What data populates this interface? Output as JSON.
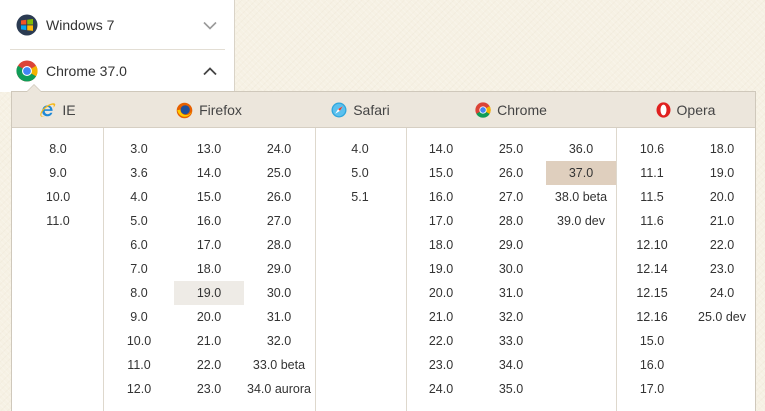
{
  "selector": {
    "os": {
      "label": "Windows 7",
      "icon": "windows-logo-icon",
      "toggle_icon": "chevron-down-icon"
    },
    "browser": {
      "label": "Chrome 37.0",
      "icon": "chrome-logo-icon",
      "toggle_icon": "chevron-up-icon"
    }
  },
  "dropdown": {
    "browsers": [
      {
        "name": "IE",
        "icon": "ie-icon",
        "columns": [
          [
            "8.0",
            "9.0",
            "10.0",
            "11.0"
          ]
        ]
      },
      {
        "name": "Firefox",
        "icon": "firefox-icon",
        "columns": [
          [
            "3.0",
            "3.6",
            "4.0",
            "5.0",
            "6.0",
            "7.0",
            "8.0",
            "9.0",
            "10.0",
            "11.0",
            "12.0"
          ],
          [
            "13.0",
            "14.0",
            "15.0",
            "16.0",
            "17.0",
            "18.0",
            "19.0",
            "20.0",
            "21.0",
            "22.0",
            "23.0"
          ],
          [
            "24.0",
            "25.0",
            "26.0",
            "27.0",
            "28.0",
            "29.0",
            "30.0",
            "31.0",
            "32.0",
            "33.0 beta",
            "34.0 aurora"
          ]
        ]
      },
      {
        "name": "Safari",
        "icon": "safari-icon",
        "columns": [
          [
            "4.0",
            "5.0",
            "5.1"
          ]
        ]
      },
      {
        "name": "Chrome",
        "icon": "chrome-icon",
        "columns": [
          [
            "14.0",
            "15.0",
            "16.0",
            "17.0",
            "18.0",
            "19.0",
            "20.0",
            "21.0",
            "22.0",
            "23.0",
            "24.0"
          ],
          [
            "25.0",
            "26.0",
            "27.0",
            "28.0",
            "29.0",
            "30.0",
            "31.0",
            "32.0",
            "33.0",
            "34.0",
            "35.0"
          ],
          [
            "36.0",
            "37.0",
            "38.0 beta",
            "39.0 dev"
          ]
        ]
      },
      {
        "name": "Opera",
        "icon": "opera-icon",
        "columns": [
          [
            "10.6",
            "11.1",
            "11.5",
            "11.6",
            "12.10",
            "12.14",
            "12.15",
            "12.16",
            "15.0",
            "16.0",
            "17.0"
          ],
          [
            "18.0",
            "19.0",
            "20.0",
            "21.0",
            "22.0",
            "23.0",
            "24.0",
            "25.0 dev"
          ]
        ]
      }
    ],
    "selected_version": "37.0",
    "hovered_version": "19.0"
  },
  "colors": {
    "header_bg": "#ece6dc",
    "selected_bg": "#dfcfbe",
    "hover_bg": "#eeebe6",
    "page_bg": "#f6f1e4"
  }
}
